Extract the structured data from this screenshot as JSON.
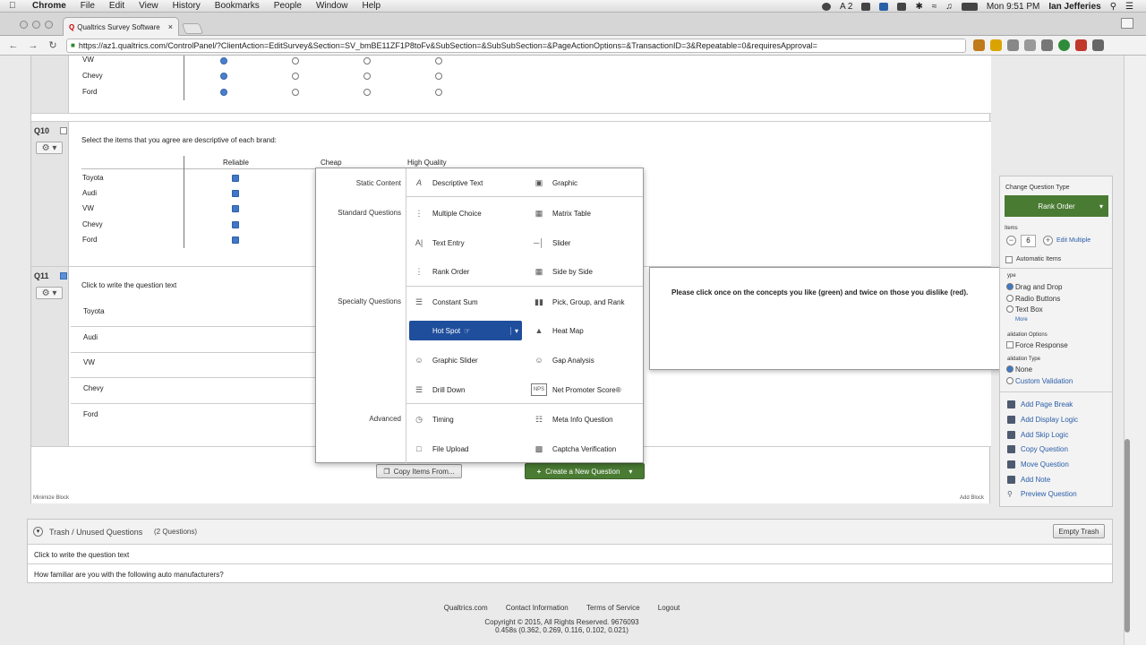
{
  "mac_menu": {
    "app": "Chrome",
    "items": [
      "File",
      "Edit",
      "View",
      "History",
      "Bookmarks",
      "People",
      "Window",
      "Help"
    ],
    "clock": "Mon 9:51 PM",
    "user": "Ian Jefferies",
    "badge": "2"
  },
  "browser": {
    "tab_title": "Qualtrics Survey Software",
    "url": "https://az1.qualtrics.com/ControlPanel/?ClientAction=EditSurvey&Section=SV_bmBE11ZF1P8toFv&SubSection=&SubSubSection=&PageActionOptions=&TransactionID=3&Repeatable=0&requiresApproval="
  },
  "q9": {
    "rows": [
      "VW",
      "Chevy",
      "Ford"
    ]
  },
  "q10": {
    "label": "Q10",
    "text": "Select the items that you agree are descriptive of each brand:",
    "columns": [
      "Reliable",
      "Cheap",
      "High Quality"
    ],
    "rows": [
      "Toyota",
      "Audi",
      "VW",
      "Chevy",
      "Ford"
    ]
  },
  "q11": {
    "label": "Q11",
    "text": "Click to write the question text",
    "rows": [
      "Toyota",
      "Audi",
      "VW",
      "Chevy",
      "Ford"
    ]
  },
  "block": {
    "minimize": "Minimize Block",
    "add_block": "Add Block",
    "copy_items": "Copy Items From...",
    "create_question": "Create a New Question"
  },
  "question_types": {
    "categories": [
      "Static Content",
      "Standard Questions",
      "Specialty Questions",
      "Advanced"
    ],
    "static": [
      "Descriptive Text",
      "Graphic"
    ],
    "standard": [
      "Multiple Choice",
      "Matrix Table",
      "Text Entry",
      "Slider",
      "Rank Order",
      "Side by Side"
    ],
    "specialty": [
      "Constant Sum",
      "Pick, Group, and Rank",
      "Hot Spot",
      "Heat Map",
      "Graphic Slider",
      "Gap Analysis",
      "Drill Down",
      "Net Promoter Score®"
    ],
    "advanced": [
      "Timing",
      "Meta Info Question",
      "File Upload",
      "Captcha Verification"
    ]
  },
  "tooltip": {
    "text": "Please click once on the concepts you like (green) and twice on those you dislike (red)."
  },
  "side_panel": {
    "change_type_label": "Change Question Type",
    "type": "Rank Order",
    "items_label": "Items",
    "items_value": "6",
    "edit_multiple": "Edit Multiple",
    "automatic_items": "Automatic Items",
    "type_label": "ype",
    "type_options": [
      "Drag and Drop",
      "Radio Buttons",
      "Text Box"
    ],
    "more": "More",
    "validation_options_label": "alidation Options",
    "force_response": "Force Response",
    "validation_type_label": "alidation Type",
    "validation_options": [
      "None",
      "Custom Validation"
    ],
    "actions": [
      "Add Page Break",
      "Add Display Logic",
      "Add Skip Logic",
      "Copy Question",
      "Move Question",
      "Add Note",
      "Preview Question"
    ]
  },
  "trash": {
    "title": "Trash / Unused Questions",
    "count": "(2 Questions)",
    "empty_button": "Empty Trash",
    "items": [
      "Click to write the question text",
      "How familiar are you with the following auto manufacturers?"
    ]
  },
  "footer": {
    "links": [
      "Qualtrics.com",
      "Contact Information",
      "Terms of Service",
      "Logout"
    ],
    "copyright": "Copyright © 2015, All Rights Reserved. 9676093",
    "timing": "0.458s (0.362, 0.269, 0.116, 0.102, 0.021)"
  },
  "colors": {
    "accent_green": "#4a7b33",
    "selected_blue": "#1f4e9c",
    "link_blue": "#2a5ea8"
  }
}
